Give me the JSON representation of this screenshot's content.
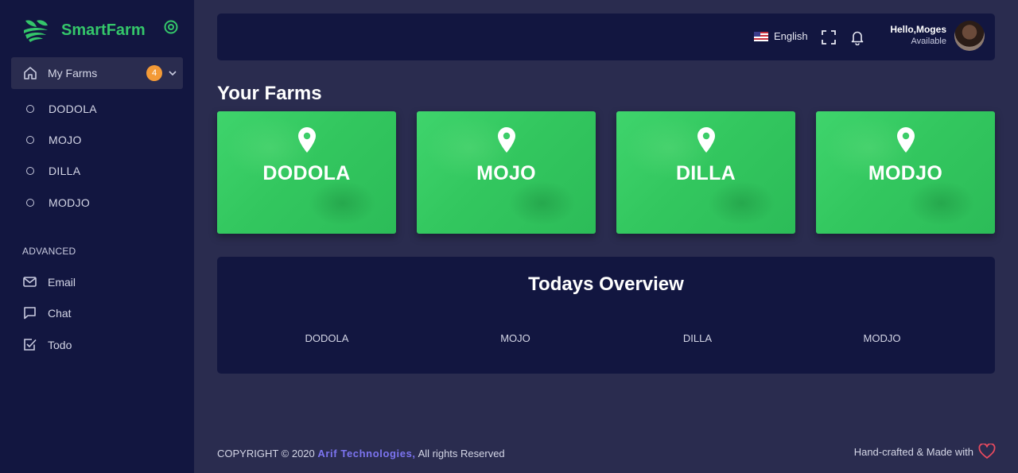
{
  "brand": {
    "name": "SmartFarm",
    "color": "#34c66a"
  },
  "sidebar": {
    "main_menu": {
      "label": "My Farms",
      "badge": "4"
    },
    "farms": [
      {
        "label": "DODOLA"
      },
      {
        "label": "MOJO"
      },
      {
        "label": "DILLA"
      },
      {
        "label": "MODJO"
      }
    ],
    "section_label": "ADVANCED",
    "advanced": [
      {
        "label": "Email",
        "icon": "mail-icon"
      },
      {
        "label": "Chat",
        "icon": "chat-icon"
      },
      {
        "label": "Todo",
        "icon": "checkbox-icon"
      }
    ]
  },
  "header": {
    "language": "English",
    "user": {
      "greeting": "Hello,Moges",
      "status": "Available"
    }
  },
  "main": {
    "title": "Your Farms",
    "farm_cards": [
      {
        "name": "DODOLA"
      },
      {
        "name": "MOJO"
      },
      {
        "name": "DILLA"
      },
      {
        "name": "MODJO"
      }
    ],
    "overview": {
      "title": "Todays Overview",
      "columns": [
        "DODOLA",
        "MOJO",
        "DILLA",
        "MODJO"
      ]
    }
  },
  "footer": {
    "copyright_prefix": "COPYRIGHT © 2020",
    "company": "Arif Technologies,",
    "rights": "All rights Reserved",
    "made_with": "Hand-crafted & Made with"
  },
  "colors": {
    "accent": "#34c66a",
    "sidebar_bg": "#121640",
    "page_bg": "#2a2c4f",
    "badge": "#f39a37",
    "company_link": "#7c74f0",
    "heart": "#e84a5f"
  }
}
